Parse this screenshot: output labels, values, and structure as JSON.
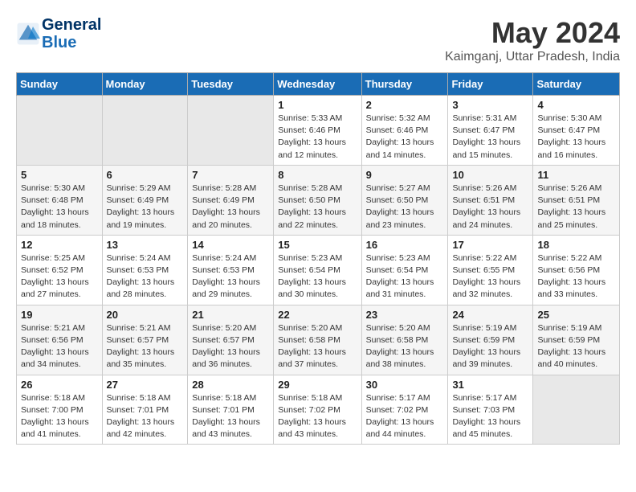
{
  "header": {
    "logo_line1": "General",
    "logo_line2": "Blue",
    "month_year": "May 2024",
    "location": "Kaimganj, Uttar Pradesh, India"
  },
  "weekdays": [
    "Sunday",
    "Monday",
    "Tuesday",
    "Wednesday",
    "Thursday",
    "Friday",
    "Saturday"
  ],
  "weeks": [
    [
      {
        "day": "",
        "info": ""
      },
      {
        "day": "",
        "info": ""
      },
      {
        "day": "",
        "info": ""
      },
      {
        "day": "1",
        "info": "Sunrise: 5:33 AM\nSunset: 6:46 PM\nDaylight: 13 hours\nand 12 minutes."
      },
      {
        "day": "2",
        "info": "Sunrise: 5:32 AM\nSunset: 6:46 PM\nDaylight: 13 hours\nand 14 minutes."
      },
      {
        "day": "3",
        "info": "Sunrise: 5:31 AM\nSunset: 6:47 PM\nDaylight: 13 hours\nand 15 minutes."
      },
      {
        "day": "4",
        "info": "Sunrise: 5:30 AM\nSunset: 6:47 PM\nDaylight: 13 hours\nand 16 minutes."
      }
    ],
    [
      {
        "day": "5",
        "info": "Sunrise: 5:30 AM\nSunset: 6:48 PM\nDaylight: 13 hours\nand 18 minutes."
      },
      {
        "day": "6",
        "info": "Sunrise: 5:29 AM\nSunset: 6:49 PM\nDaylight: 13 hours\nand 19 minutes."
      },
      {
        "day": "7",
        "info": "Sunrise: 5:28 AM\nSunset: 6:49 PM\nDaylight: 13 hours\nand 20 minutes."
      },
      {
        "day": "8",
        "info": "Sunrise: 5:28 AM\nSunset: 6:50 PM\nDaylight: 13 hours\nand 22 minutes."
      },
      {
        "day": "9",
        "info": "Sunrise: 5:27 AM\nSunset: 6:50 PM\nDaylight: 13 hours\nand 23 minutes."
      },
      {
        "day": "10",
        "info": "Sunrise: 5:26 AM\nSunset: 6:51 PM\nDaylight: 13 hours\nand 24 minutes."
      },
      {
        "day": "11",
        "info": "Sunrise: 5:26 AM\nSunset: 6:51 PM\nDaylight: 13 hours\nand 25 minutes."
      }
    ],
    [
      {
        "day": "12",
        "info": "Sunrise: 5:25 AM\nSunset: 6:52 PM\nDaylight: 13 hours\nand 27 minutes."
      },
      {
        "day": "13",
        "info": "Sunrise: 5:24 AM\nSunset: 6:53 PM\nDaylight: 13 hours\nand 28 minutes."
      },
      {
        "day": "14",
        "info": "Sunrise: 5:24 AM\nSunset: 6:53 PM\nDaylight: 13 hours\nand 29 minutes."
      },
      {
        "day": "15",
        "info": "Sunrise: 5:23 AM\nSunset: 6:54 PM\nDaylight: 13 hours\nand 30 minutes."
      },
      {
        "day": "16",
        "info": "Sunrise: 5:23 AM\nSunset: 6:54 PM\nDaylight: 13 hours\nand 31 minutes."
      },
      {
        "day": "17",
        "info": "Sunrise: 5:22 AM\nSunset: 6:55 PM\nDaylight: 13 hours\nand 32 minutes."
      },
      {
        "day": "18",
        "info": "Sunrise: 5:22 AM\nSunset: 6:56 PM\nDaylight: 13 hours\nand 33 minutes."
      }
    ],
    [
      {
        "day": "19",
        "info": "Sunrise: 5:21 AM\nSunset: 6:56 PM\nDaylight: 13 hours\nand 34 minutes."
      },
      {
        "day": "20",
        "info": "Sunrise: 5:21 AM\nSunset: 6:57 PM\nDaylight: 13 hours\nand 35 minutes."
      },
      {
        "day": "21",
        "info": "Sunrise: 5:20 AM\nSunset: 6:57 PM\nDaylight: 13 hours\nand 36 minutes."
      },
      {
        "day": "22",
        "info": "Sunrise: 5:20 AM\nSunset: 6:58 PM\nDaylight: 13 hours\nand 37 minutes."
      },
      {
        "day": "23",
        "info": "Sunrise: 5:20 AM\nSunset: 6:58 PM\nDaylight: 13 hours\nand 38 minutes."
      },
      {
        "day": "24",
        "info": "Sunrise: 5:19 AM\nSunset: 6:59 PM\nDaylight: 13 hours\nand 39 minutes."
      },
      {
        "day": "25",
        "info": "Sunrise: 5:19 AM\nSunset: 6:59 PM\nDaylight: 13 hours\nand 40 minutes."
      }
    ],
    [
      {
        "day": "26",
        "info": "Sunrise: 5:18 AM\nSunset: 7:00 PM\nDaylight: 13 hours\nand 41 minutes."
      },
      {
        "day": "27",
        "info": "Sunrise: 5:18 AM\nSunset: 7:01 PM\nDaylight: 13 hours\nand 42 minutes."
      },
      {
        "day": "28",
        "info": "Sunrise: 5:18 AM\nSunset: 7:01 PM\nDaylight: 13 hours\nand 43 minutes."
      },
      {
        "day": "29",
        "info": "Sunrise: 5:18 AM\nSunset: 7:02 PM\nDaylight: 13 hours\nand 43 minutes."
      },
      {
        "day": "30",
        "info": "Sunrise: 5:17 AM\nSunset: 7:02 PM\nDaylight: 13 hours\nand 44 minutes."
      },
      {
        "day": "31",
        "info": "Sunrise: 5:17 AM\nSunset: 7:03 PM\nDaylight: 13 hours\nand 45 minutes."
      },
      {
        "day": "",
        "info": ""
      }
    ]
  ]
}
